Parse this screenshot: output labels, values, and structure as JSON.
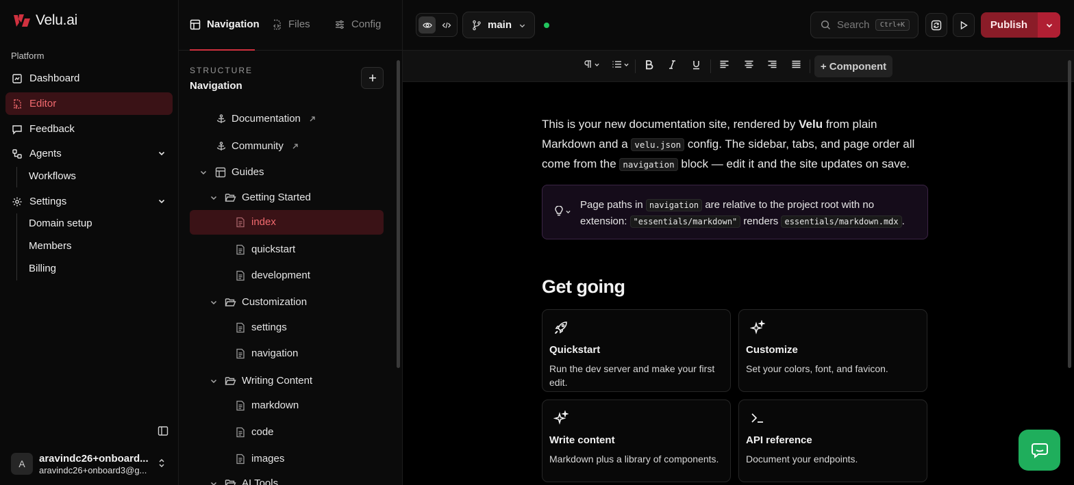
{
  "app": {
    "logo_text": "Velu.ai",
    "brand_color": "#d0313f"
  },
  "sidebar": {
    "section_label": "Platform",
    "items": [
      {
        "label": "Dashboard",
        "icon": "dashboard-icon"
      },
      {
        "label": "Editor",
        "icon": "editor-icon",
        "active": true
      },
      {
        "label": "Feedback",
        "icon": "feedback-icon"
      },
      {
        "label": "Agents",
        "icon": "agents-icon",
        "expanded": true
      },
      {
        "label": "Settings",
        "icon": "gear-icon",
        "expanded": true
      }
    ],
    "agents_children": [
      "Workflows"
    ],
    "settings_children": [
      "Domain setup",
      "Members",
      "Billing"
    ],
    "user": {
      "initial": "A",
      "name": "aravindc26+onboard...",
      "email": "aravindc26+onboard3@g..."
    }
  },
  "panel": {
    "tabs": [
      {
        "label": "Navigation",
        "active": true
      },
      {
        "label": "Files"
      },
      {
        "label": "Config"
      }
    ],
    "structure_label": "STRUCTURE",
    "structure_title": "Navigation",
    "tree": [
      {
        "label": "Documentation",
        "type": "anchor",
        "external": true
      },
      {
        "label": "Community",
        "type": "anchor",
        "external": true
      },
      {
        "label": "Guides",
        "type": "tab"
      },
      {
        "label": "Getting Started",
        "type": "group"
      },
      {
        "label": "index",
        "type": "page",
        "active": true
      },
      {
        "label": "quickstart",
        "type": "page"
      },
      {
        "label": "development",
        "type": "page"
      },
      {
        "label": "Customization",
        "type": "group"
      },
      {
        "label": "settings",
        "type": "page"
      },
      {
        "label": "navigation",
        "type": "page"
      },
      {
        "label": "Writing Content",
        "type": "group"
      },
      {
        "label": "markdown",
        "type": "page"
      },
      {
        "label": "code",
        "type": "page"
      },
      {
        "label": "images",
        "type": "page"
      },
      {
        "label": "AI Tools",
        "type": "group"
      }
    ]
  },
  "topbar": {
    "branch": "main",
    "search_placeholder": "Search",
    "search_shortcut": "Ctrl+K",
    "publish_label": "Publish",
    "status_color": "#22c55e"
  },
  "toolbar": {
    "component_label": "+ Component"
  },
  "content": {
    "intro": {
      "p1": "This is your new documentation site, rendered by ",
      "brand": "Velu",
      "p2": " from plain Markdown and a ",
      "code1": "velu.json",
      "p3": " config. The sidebar, tabs, and page order all come from the ",
      "code2": "navigation",
      "p4": " block — edit it and the site updates on save."
    },
    "callout": {
      "t1": "Page paths in ",
      "code1": "navigation",
      "t2": " are relative to the project root with no extension: ",
      "code2": "\"essentials/markdown\"",
      "t3": " renders ",
      "code3": "essentials/markdown.mdx",
      "t4": "."
    },
    "heading": "Get going",
    "cards": [
      {
        "title": "Quickstart",
        "desc": "Run the dev server and make your first edit.",
        "icon": "rocket-icon"
      },
      {
        "title": "Customize",
        "desc": "Set your colors, font, and favicon.",
        "icon": "sparkles-icon"
      },
      {
        "title": "Write content",
        "desc": "Markdown plus a library of components.",
        "icon": "sparkles-icon"
      },
      {
        "title": "API reference",
        "desc": "Document your endpoints.",
        "icon": "terminal-icon"
      }
    ]
  }
}
